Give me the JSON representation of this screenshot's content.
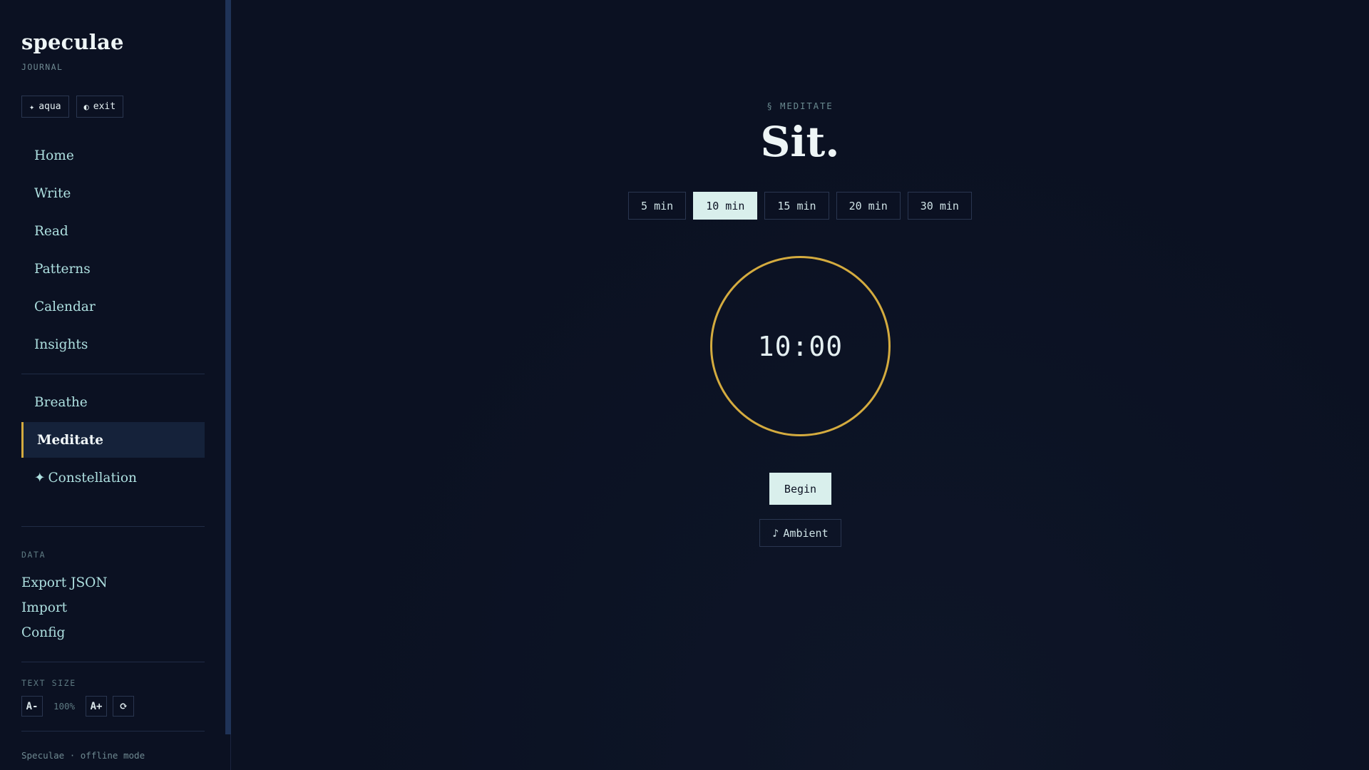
{
  "brand": {
    "title": "speculae",
    "subtitle": "JOURNAL"
  },
  "chips": [
    {
      "icon": "✦",
      "label": "aqua"
    },
    {
      "icon": "◐",
      "label": "exit"
    }
  ],
  "nav": {
    "primary": [
      "Home",
      "Write",
      "Read",
      "Patterns",
      "Calendar",
      "Insights"
    ],
    "practice": [
      {
        "label": "Breathe",
        "active": false
      },
      {
        "label": "Meditate",
        "active": true
      },
      {
        "label": "Constellation",
        "icon": "✦",
        "active": false
      }
    ]
  },
  "data_section": {
    "label": "DATA",
    "links": [
      "Export JSON",
      "Import",
      "Config"
    ]
  },
  "text_size": {
    "label": "TEXT SIZE",
    "decrease": "A-",
    "value": "100%",
    "increase": "A+",
    "reset_icon": "⟳"
  },
  "footer": "Speculae · offline mode",
  "main": {
    "kicker": "§ MEDITATE",
    "title": "Sit.",
    "durations": [
      "5 min",
      "10 min",
      "15 min",
      "20 min",
      "30 min"
    ],
    "selected_duration": "10 min",
    "timer": "10:00",
    "begin": "Begin",
    "ambient": {
      "icon": "♪",
      "label": "Ambient"
    }
  },
  "colors": {
    "background": "#0b1122",
    "accent_gold": "#d4ab3f",
    "selected_bg": "#d9efec",
    "nav_text": "#aee0e0"
  }
}
